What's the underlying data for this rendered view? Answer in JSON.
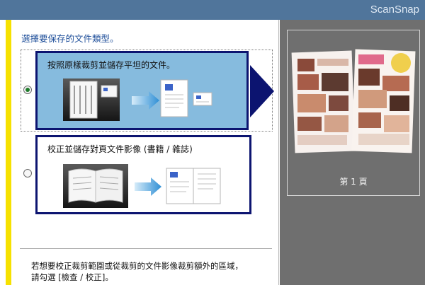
{
  "window": {
    "title": "ScanSnap"
  },
  "main": {
    "heading": "選擇要保存的文件類型。",
    "options": [
      {
        "label": "按照原樣裁剪並儲存平坦的文件。",
        "selected": true
      },
      {
        "label": "校正並儲存對頁文件影像 (書籍 / 雜誌)",
        "selected": false
      }
    ],
    "hint_lines": [
      "若想要校正裁剪範圍或從裁剪的文件影像裁剪額外的區域，",
      "請勾選 [檢查 / 校正]。"
    ]
  },
  "preview": {
    "page_label": "第 1 頁"
  },
  "colors": {
    "accent_yellow": "#f6e100",
    "selection_blue": "#86bbde",
    "border_navy": "#0c1470",
    "heading_blue": "#1f4f9a",
    "preview_gray": "#6f6f6f"
  }
}
